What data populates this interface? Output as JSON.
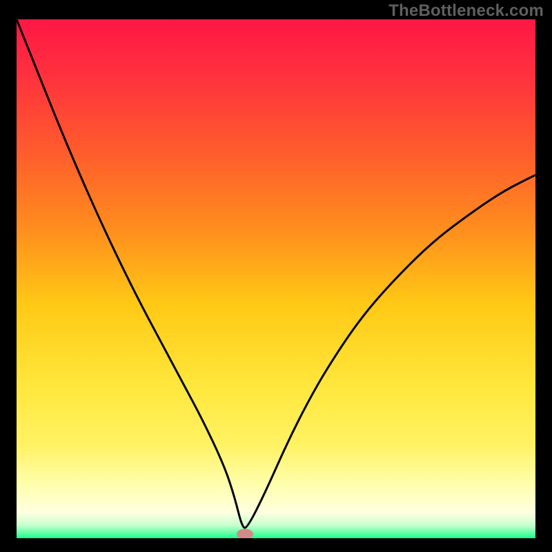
{
  "watermark": "TheBottleneck.com",
  "chart_data": {
    "type": "line",
    "title": "",
    "xlabel": "",
    "ylabel": "",
    "xlim": [
      0,
      100
    ],
    "ylim": [
      0,
      100
    ],
    "grid": false,
    "gradient_stops": [
      {
        "offset": 0.0,
        "color": "#ff1744"
      },
      {
        "offset": 0.1,
        "color": "#ff2f3f"
      },
      {
        "offset": 0.25,
        "color": "#ff5a2d"
      },
      {
        "offset": 0.4,
        "color": "#ff8c1e"
      },
      {
        "offset": 0.55,
        "color": "#ffc915"
      },
      {
        "offset": 0.7,
        "color": "#ffe63a"
      },
      {
        "offset": 0.82,
        "color": "#fff263"
      },
      {
        "offset": 0.9,
        "color": "#ffffb0"
      },
      {
        "offset": 0.95,
        "color": "#ffffe0"
      },
      {
        "offset": 0.975,
        "color": "#c8ffd0"
      },
      {
        "offset": 1.0,
        "color": "#1aff8a"
      }
    ],
    "series": [
      {
        "name": "curve",
        "x": [
          0.0,
          4.0,
          8.0,
          12.0,
          16.0,
          20.0,
          24.0,
          28.0,
          32.0,
          36.0,
          40.0,
          42.0,
          43.5,
          44.5,
          48.0,
          52.0,
          56.0,
          60.0,
          66.0,
          72.0,
          80.0,
          88.0,
          94.0,
          100.0
        ],
        "y": [
          100.0,
          90.0,
          80.0,
          70.5,
          61.5,
          53.0,
          45.0,
          37.5,
          30.0,
          22.5,
          14.0,
          8.0,
          2.0,
          2.0,
          9.0,
          18.0,
          26.0,
          33.0,
          42.0,
          49.0,
          57.0,
          63.0,
          67.0,
          70.0
        ]
      }
    ],
    "marker": {
      "x": 44.0,
      "y": 0.8,
      "rx": 1.6,
      "ry": 1.0,
      "color": "#d08a88"
    }
  }
}
